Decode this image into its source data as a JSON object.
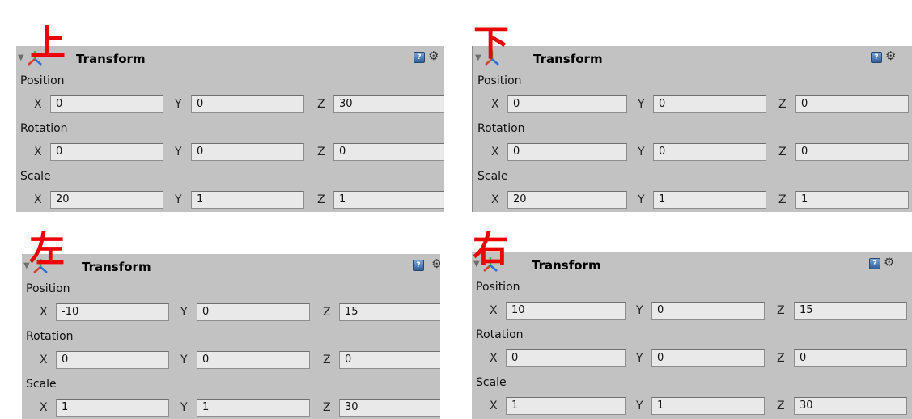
{
  "panels": [
    {
      "marker": "上",
      "title": "Transform",
      "position_label": "Position",
      "rotation_label": "Rotation",
      "scale_label": "Scale",
      "axes": {
        "x": "X",
        "y": "Y",
        "z": "Z"
      },
      "position": {
        "x": "0",
        "y": "0",
        "z": "30"
      },
      "rotation": {
        "x": "0",
        "y": "0",
        "z": "0"
      },
      "scale": {
        "x": "20",
        "y": "1",
        "z": "1"
      }
    },
    {
      "marker": "下",
      "title": "Transform",
      "position_label": "Position",
      "rotation_label": "Rotation",
      "scale_label": "Scale",
      "axes": {
        "x": "X",
        "y": "Y",
        "z": "Z"
      },
      "position": {
        "x": "0",
        "y": "0",
        "z": "0"
      },
      "rotation": {
        "x": "0",
        "y": "0",
        "z": "0"
      },
      "scale": {
        "x": "20",
        "y": "1",
        "z": "1"
      }
    },
    {
      "marker": "左",
      "title": "Transform",
      "position_label": "Position",
      "rotation_label": "Rotation",
      "scale_label": "Scale",
      "axes": {
        "x": "X",
        "y": "Y",
        "z": "Z"
      },
      "position": {
        "x": "-10",
        "y": "0",
        "z": "15"
      },
      "rotation": {
        "x": "0",
        "y": "0",
        "z": "0"
      },
      "scale": {
        "x": "1",
        "y": "1",
        "z": "30"
      }
    },
    {
      "marker": "右",
      "title": "Transform",
      "position_label": "Position",
      "rotation_label": "Rotation",
      "scale_label": "Scale",
      "axes": {
        "x": "X",
        "y": "Y",
        "z": "Z"
      },
      "position": {
        "x": "10",
        "y": "0",
        "z": "15"
      },
      "rotation": {
        "x": "0",
        "y": "0",
        "z": "0"
      },
      "scale": {
        "x": "1",
        "y": "1",
        "z": "30"
      }
    }
  ],
  "icons": {
    "foldout": "foldout-triangle-icon",
    "transform": "transform-axes-icon",
    "help": "help-book-icon",
    "settings": "gear-icon"
  },
  "colors": {
    "panel_bg": "#c2c2c2",
    "field_bg": "#e9e9e9",
    "marker": "#ee0000"
  }
}
